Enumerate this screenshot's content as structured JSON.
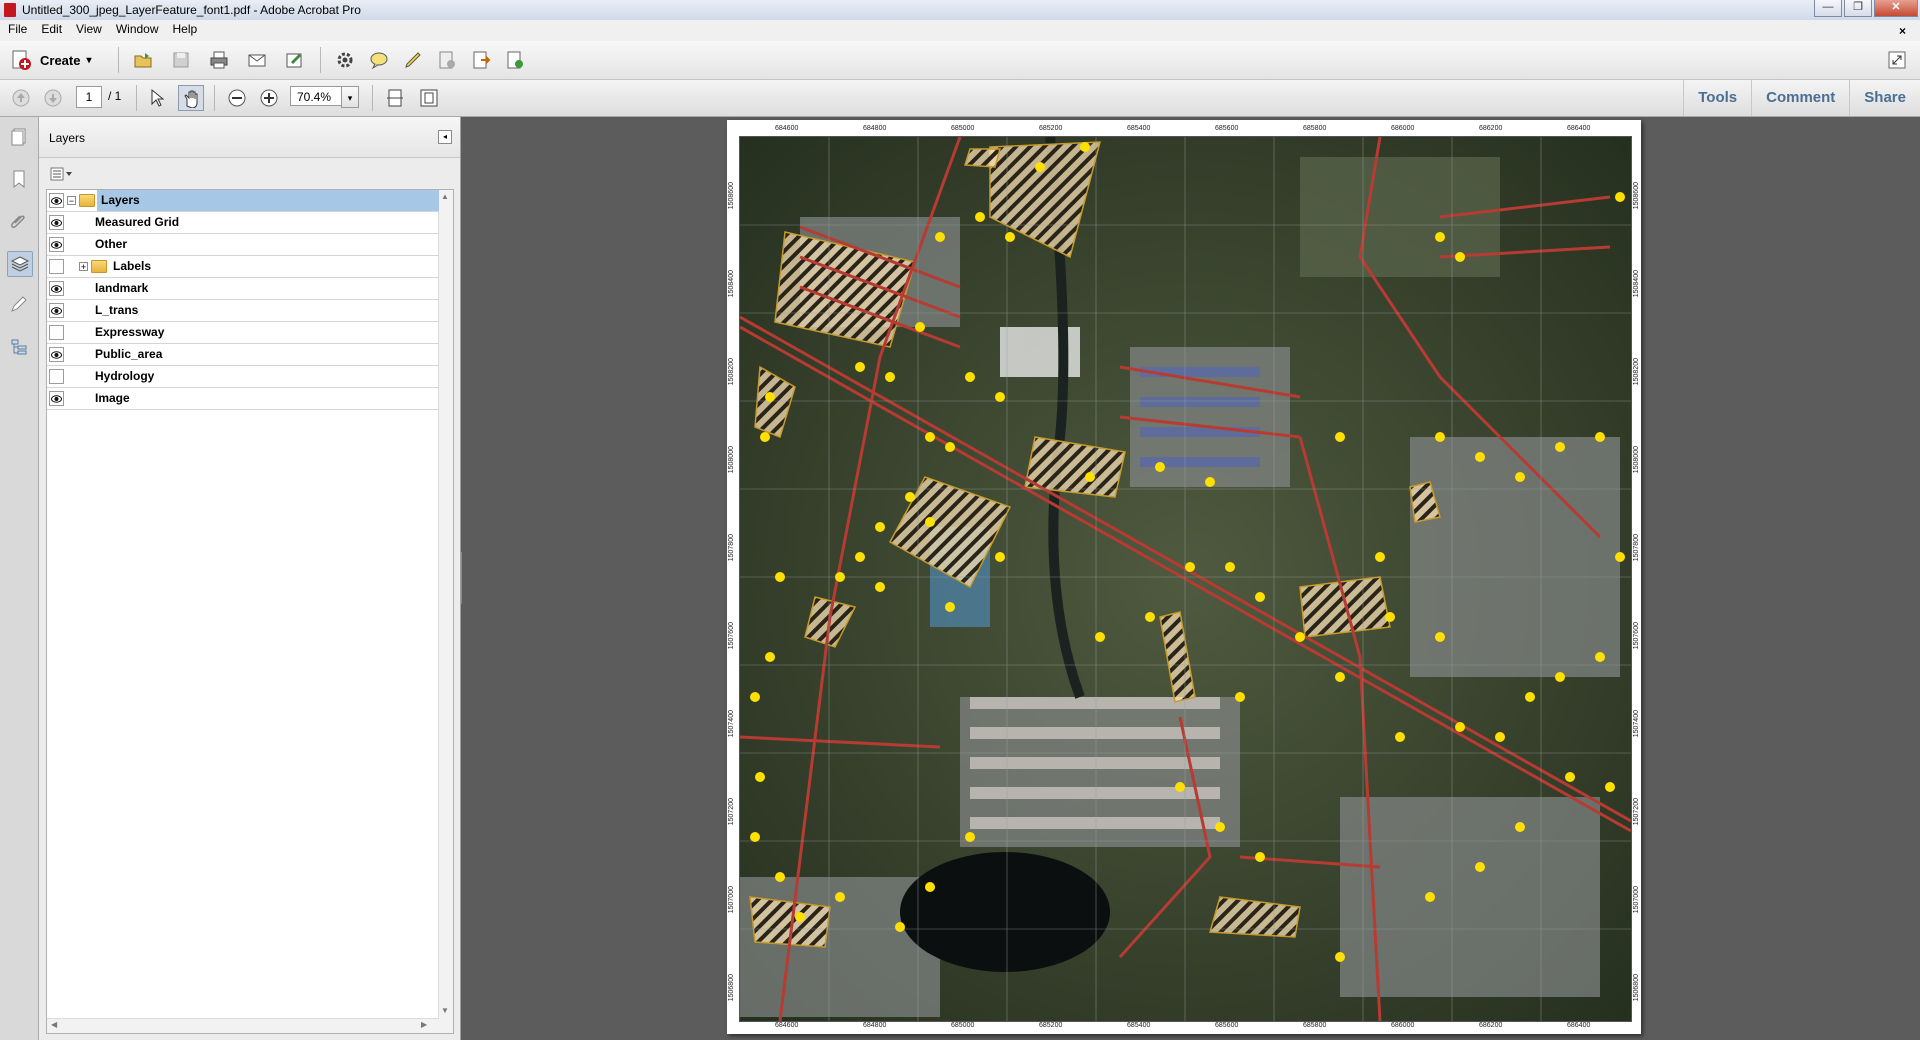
{
  "window": {
    "title": "Untitled_300_jpeg_LayerFeature_font1.pdf - Adobe Acrobat Pro",
    "minimize": "—",
    "restore": "❐",
    "close": "✕"
  },
  "menu": {
    "file": "File",
    "edit": "Edit",
    "view": "View",
    "window": "Window",
    "help": "Help",
    "close_doc": "×"
  },
  "toolbar": {
    "create_label": "Create",
    "create_arrow": "▾",
    "page_current": "1",
    "page_total": "/ 1",
    "zoom_value": "70.4%",
    "zoom_arrow": "▾"
  },
  "right_panel_links": {
    "tools": "Tools",
    "comment": "Comment",
    "share": "Share"
  },
  "layers_panel": {
    "title": "Layers",
    "collapse": "◂",
    "items": [
      {
        "label": "Layers",
        "visible": true,
        "expander": "−",
        "folder": true,
        "selected": true
      },
      {
        "label": "Measured Grid",
        "visible": true
      },
      {
        "label": "Other",
        "visible": true
      },
      {
        "label": "Labels",
        "visible": false,
        "expander": "+",
        "folder": true
      },
      {
        "label": "landmark",
        "visible": true
      },
      {
        "label": "L_trans",
        "visible": true
      },
      {
        "label": "Expressway",
        "visible": false
      },
      {
        "label": "Public_area",
        "visible": true
      },
      {
        "label": "Hydrology",
        "visible": false
      },
      {
        "label": "Image",
        "visible": true
      }
    ]
  },
  "map": {
    "top_labels": [
      "684600",
      "684800",
      "685000",
      "685200",
      "685400",
      "685600",
      "685800",
      "686000",
      "686200",
      "686400"
    ],
    "bottom_labels": [
      "684600",
      "684800",
      "685000",
      "685200",
      "685400",
      "685600",
      "685800",
      "686000",
      "686200",
      "686400"
    ],
    "left_labels": [
      "1508600",
      "1508400",
      "1508200",
      "1508000",
      "1507800",
      "1507600",
      "1507400",
      "1507200",
      "1507000",
      "1506800"
    ],
    "right_labels": [
      "1508600",
      "1508400",
      "1508200",
      "1508000",
      "1507800",
      "1507600",
      "1507400",
      "1507200",
      "1507000",
      "1506800"
    ]
  },
  "colors": {
    "accent_links": "#4a6f94",
    "selection": "#a7c7e6",
    "road": "#c0392b",
    "landmark": "#ffe000",
    "public_area": "#f5deb3"
  }
}
